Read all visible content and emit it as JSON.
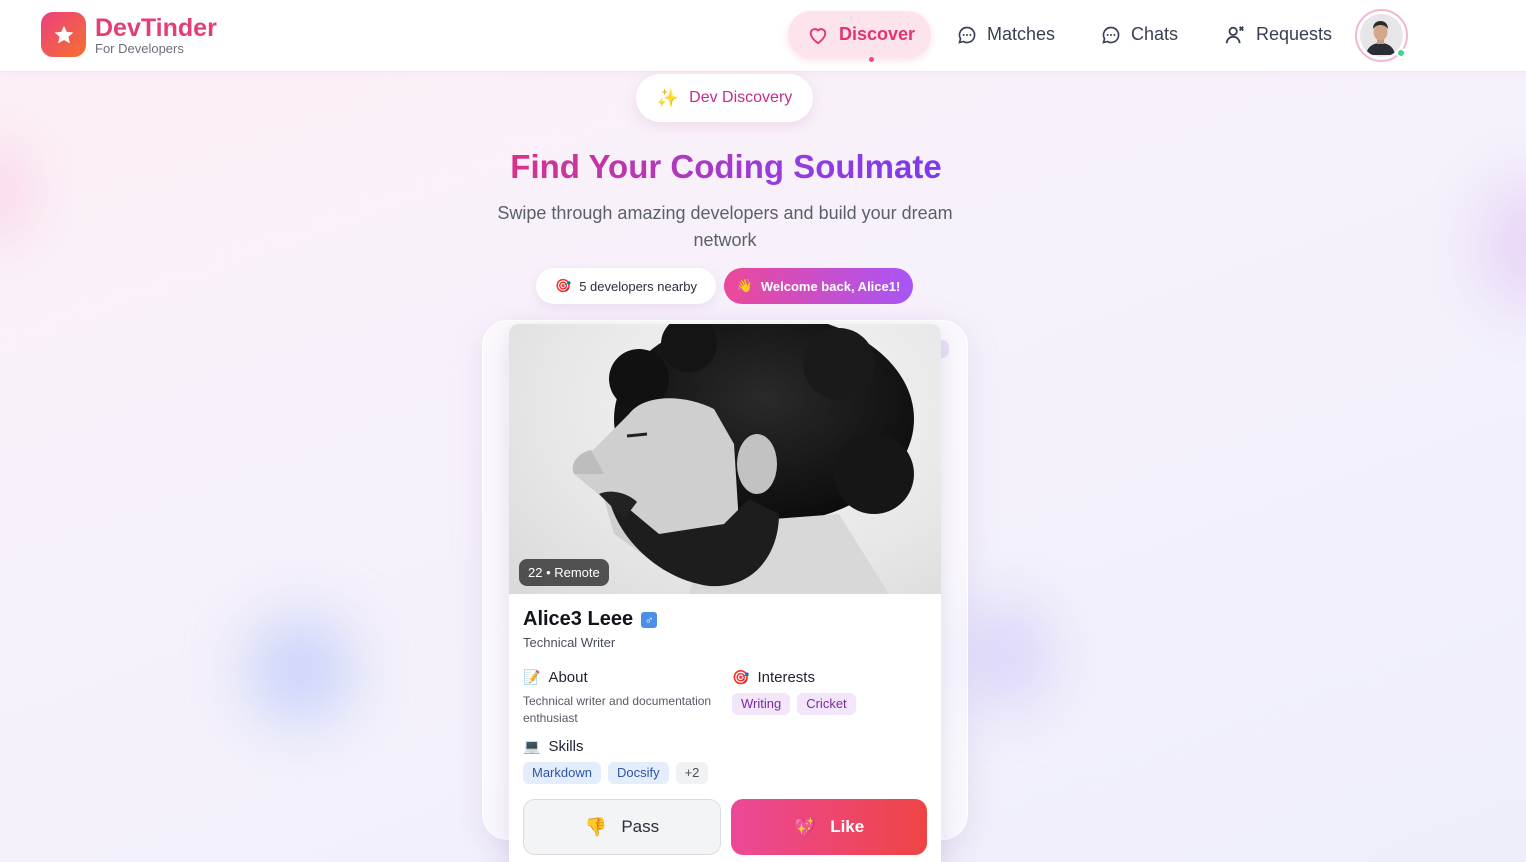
{
  "brand": {
    "title": "DevTinder",
    "subtitle": "For Developers",
    "logo_icon": "star-icon",
    "accent": "#e53e74"
  },
  "nav": {
    "discover": "Discover",
    "matches": "Matches",
    "chats": "Chats",
    "requests": "Requests",
    "active": "Discover"
  },
  "user": {
    "avatar": "user-avatar",
    "status": "online"
  },
  "hero": {
    "pill": "Dev Discovery",
    "title": "Find Your Coding Soulmate",
    "subtitle": "Swipe through amazing developers and build your dream network",
    "nearby": "5 developers nearby",
    "welcome": "Welcome back, Alice1!"
  },
  "card": {
    "badge": "22 • Remote",
    "name": "Alice3 Leee",
    "gender_icon": "male-icon",
    "role": "Technical Writer",
    "about_title": "About",
    "about_text": "Technical writer and documentation enthusiast",
    "interests_title": "Interests",
    "interests": [
      "Writing",
      "Cricket"
    ],
    "skills_title": "Skills",
    "skills": [
      "Markdown",
      "Docsify"
    ],
    "skills_more": "+2",
    "pass_label": "Pass",
    "like_label": "Like"
  },
  "colors": {
    "like_gradient_start": "#ec4899",
    "like_gradient_end": "#ef4444",
    "welcome_start": "#ec4899",
    "welcome_end": "#a855f7"
  }
}
